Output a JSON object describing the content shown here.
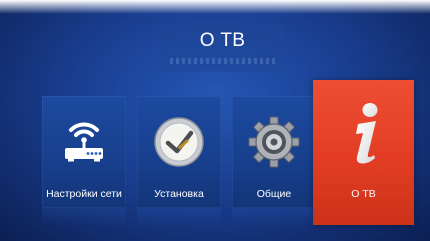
{
  "header": {
    "title": "О ТВ"
  },
  "tiles": [
    {
      "label": "Настройки сети",
      "icon": "router-icon",
      "selected": false
    },
    {
      "label": "Установка",
      "icon": "clock-icon",
      "selected": false
    },
    {
      "label": "Общие",
      "icon": "gear-icon",
      "selected": false
    },
    {
      "label": "О ТВ",
      "icon": "info-icon",
      "selected": true
    }
  ],
  "colors": {
    "background": "#1a3f92",
    "tile": "#1d4aa0",
    "selected_tile": "#e8452c",
    "text": "#ffffff"
  }
}
